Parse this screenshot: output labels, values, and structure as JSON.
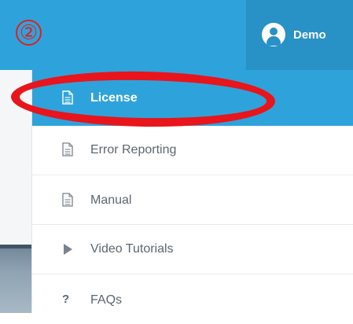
{
  "step_marker": "②",
  "user": {
    "name": "Demo",
    "icon": "user-avatar-icon"
  },
  "menu": {
    "items": [
      {
        "label": "License",
        "icon": "document-icon",
        "active": true
      },
      {
        "label": "Error Reporting",
        "icon": "document-icon",
        "active": false
      },
      {
        "label": "Manual",
        "icon": "document-icon",
        "active": false
      },
      {
        "label": "Video Tutorials",
        "icon": "play-icon",
        "active": false
      },
      {
        "label": "FAQs",
        "icon": "question-icon",
        "active": false
      }
    ]
  },
  "colors": {
    "topbar": "#2ea3db",
    "user_area": "#2891c6",
    "active_item": "#2ea3db",
    "annotation": "#e8151c",
    "menu_text": "#5c6670"
  }
}
